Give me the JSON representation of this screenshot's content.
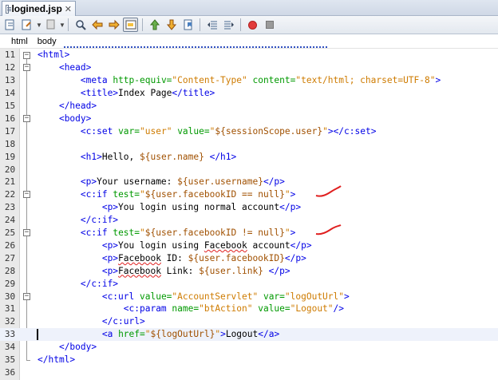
{
  "tab": {
    "title": "logined.jsp",
    "close": "✕"
  },
  "toolbar": {
    "buttons": [
      "source-history-icon",
      "last-edit-icon",
      "back-icon",
      "find-icon",
      "find-prev-icon",
      "find-next-icon",
      "toggle-highlight-icon",
      "prev-bookmark-icon",
      "next-bookmark-icon",
      "toggle-bookmark-icon",
      "shift-left-icon",
      "shift-right-icon",
      "record-macro-icon",
      "stop-macro-icon"
    ]
  },
  "breadcrumb": {
    "items": [
      "html",
      "body"
    ]
  },
  "editor": {
    "line_numbers": [
      "11",
      "12",
      "13",
      "14",
      "15",
      "16",
      "17",
      "18",
      "19",
      "20",
      "21",
      "22",
      "23",
      "24",
      "25",
      "26",
      "27",
      "28",
      "29",
      "30",
      "31",
      "32",
      "33",
      "34",
      "35",
      "36"
    ],
    "current_line": "33",
    "annotation_color": "#e02020"
  }
}
